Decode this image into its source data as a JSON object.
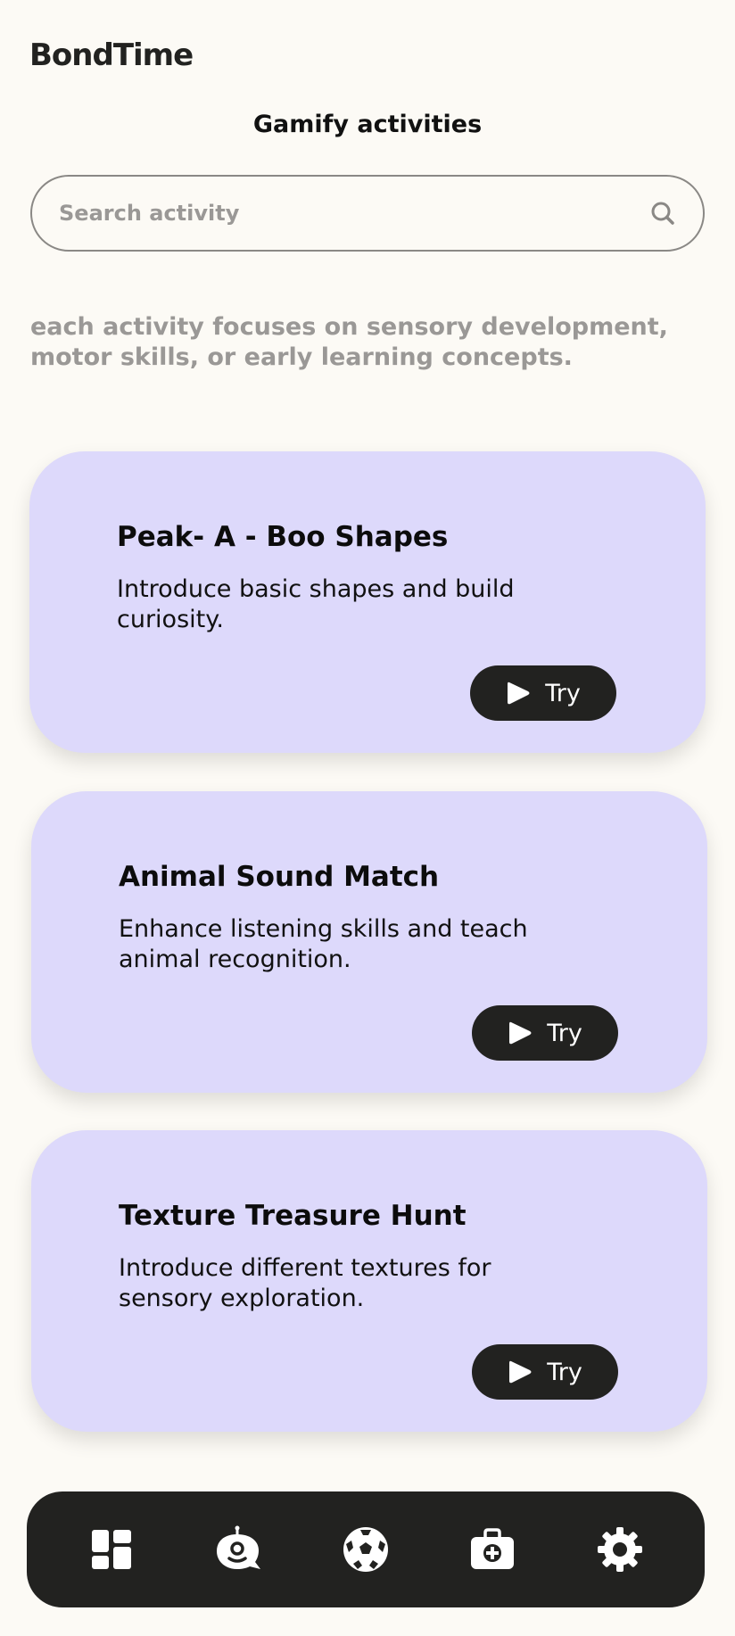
{
  "app": {
    "brand": "BondTime"
  },
  "header": {
    "title": "Gamify activities"
  },
  "search": {
    "placeholder": "Search activity",
    "value": ""
  },
  "intro": {
    "text": "each activity focuses on sensory development, motor skills, or early learning concepts."
  },
  "activities": [
    {
      "title": "Peak- A - Boo Shapes",
      "description": "Introduce basic shapes and build curiosity.",
      "button_label": "Try"
    },
    {
      "title": "Animal Sound Match",
      "description": "Enhance listening skills and teach animal recognition.",
      "button_label": "Try"
    },
    {
      "title": "Texture Treasure Hunt",
      "description": "Introduce different textures for sensory exploration.",
      "button_label": "Try"
    }
  ],
  "bottom_nav": {
    "items": [
      {
        "icon": "dashboard-icon"
      },
      {
        "icon": "chatbot-icon"
      },
      {
        "icon": "soccer-ball-icon"
      },
      {
        "icon": "medical-kit-icon"
      },
      {
        "icon": "gear-icon"
      }
    ]
  },
  "colors": {
    "background": "#FCFAF5",
    "card": "#DDD9FB",
    "dark": "#222220",
    "muted_text": "#9a9896"
  }
}
